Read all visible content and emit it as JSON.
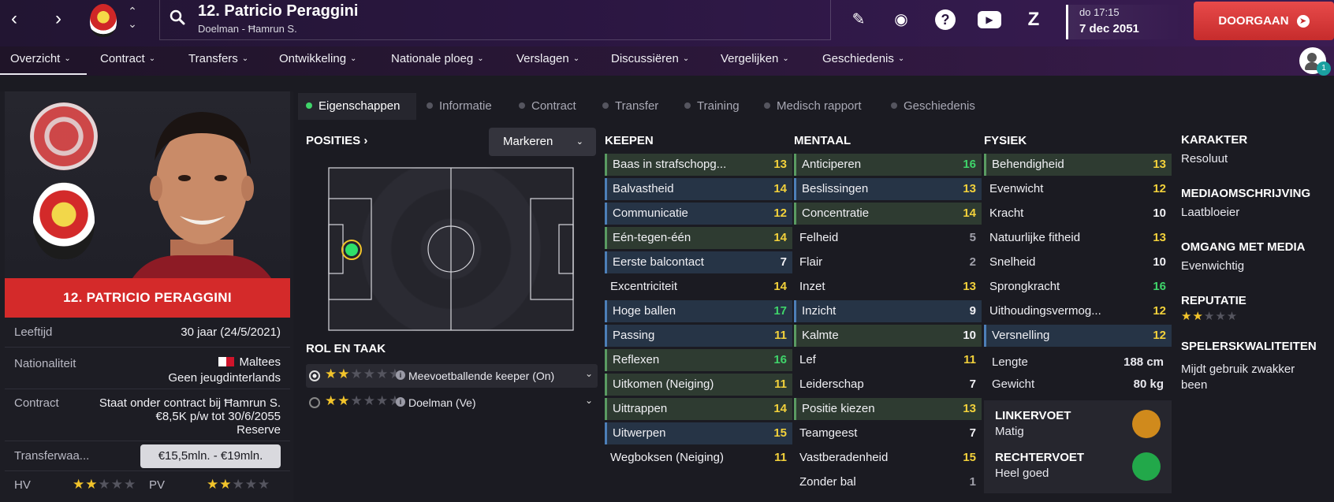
{
  "header": {
    "player_title": "12. Patricio Peraggini",
    "player_subtitle": "Doelman - Ħamrun S.",
    "date_day_time": "do 17:15",
    "date": "7 dec 2051",
    "continue_label": "DOORGAAN"
  },
  "nav": {
    "items": [
      {
        "label": "Overzicht"
      },
      {
        "label": "Contract"
      },
      {
        "label": "Transfers"
      },
      {
        "label": "Ontwikkeling"
      },
      {
        "label": "Nationale ploeg"
      },
      {
        "label": "Verslagen"
      },
      {
        "label": "Discussiëren"
      },
      {
        "label": "Vergelijken"
      },
      {
        "label": "Geschiedenis"
      }
    ],
    "social_badge": "1"
  },
  "profile": {
    "banner_name": "12. PATRICIO PERAGGINI",
    "age_label": "Leeftijd",
    "age_value": "30 jaar (24/5/2021)",
    "nationality_label": "Nationaliteit",
    "nationality_value": "Maltees",
    "nationality_sub": "Geen jeugdinterlands",
    "contract_label": "Contract",
    "contract_line1": "Staat onder contract bij Ħamrun S.",
    "contract_line2": "€8,5K p/w tot 30/6/2055",
    "contract_line3": "Reserve",
    "transfer_label": "Transferwaa...",
    "transfer_value": "€15,5mln. - €19mln.",
    "hv_label": "HV",
    "hv_stars": 2,
    "pv_label": "PV",
    "pv_stars": 2
  },
  "subtabs": [
    {
      "label": "Eigenschappen",
      "active": true
    },
    {
      "label": "Informatie"
    },
    {
      "label": "Contract"
    },
    {
      "label": "Transfer"
    },
    {
      "label": "Training"
    },
    {
      "label": "Medisch rapport"
    },
    {
      "label": "Geschiedenis"
    }
  ],
  "positions": {
    "heading": "POSITIES",
    "markeren_label": "Markeren",
    "role_heading": "ROL EN TAAK",
    "roles": [
      {
        "name": "Meevoetballende keeper (On)",
        "stars": 2,
        "selected": true
      },
      {
        "name": "Doelman (Ve)",
        "stars": 2,
        "selected": false
      }
    ]
  },
  "attributes": {
    "keepen_heading": "KEEPEN",
    "mentaal_heading": "MENTAAL",
    "fysiek_heading": "FYSIEK",
    "keepen": [
      {
        "name": "Baas in strafschopg...",
        "value": "13"
      },
      {
        "name": "Balvastheid",
        "value": "14"
      },
      {
        "name": "Communicatie",
        "value": "12"
      },
      {
        "name": "Eén-tegen-één",
        "value": "14"
      },
      {
        "name": "Eerste balcontact",
        "value": "7"
      },
      {
        "name": "Excentriciteit",
        "value": "14"
      },
      {
        "name": "Hoge ballen",
        "value": "17"
      },
      {
        "name": "Passing",
        "value": "11"
      },
      {
        "name": "Reflexen",
        "value": "16"
      },
      {
        "name": "Uitkomen (Neiging)",
        "value": "11"
      },
      {
        "name": "Uittrappen",
        "value": "14"
      },
      {
        "name": "Uitwerpen",
        "value": "15"
      },
      {
        "name": "Wegboksen (Neiging)",
        "value": "11"
      }
    ],
    "mentaal": [
      {
        "name": "Anticiperen",
        "value": "16"
      },
      {
        "name": "Beslissingen",
        "value": "13"
      },
      {
        "name": "Concentratie",
        "value": "14"
      },
      {
        "name": "Felheid",
        "value": "5"
      },
      {
        "name": "Flair",
        "value": "2"
      },
      {
        "name": "Inzet",
        "value": "13"
      },
      {
        "name": "Inzicht",
        "value": "9"
      },
      {
        "name": "Kalmte",
        "value": "10"
      },
      {
        "name": "Lef",
        "value": "11"
      },
      {
        "name": "Leiderschap",
        "value": "7"
      },
      {
        "name": "Positie kiezen",
        "value": "13"
      },
      {
        "name": "Teamgeest",
        "value": "7"
      },
      {
        "name": "Vastberadenheid",
        "value": "15"
      },
      {
        "name": "Zonder bal",
        "value": "1"
      }
    ],
    "fysiek": [
      {
        "name": "Behendigheid",
        "value": "13"
      },
      {
        "name": "Evenwicht",
        "value": "12"
      },
      {
        "name": "Kracht",
        "value": "10"
      },
      {
        "name": "Natuurlijke fitheid",
        "value": "13"
      },
      {
        "name": "Snelheid",
        "value": "10"
      },
      {
        "name": "Sprongkracht",
        "value": "16"
      },
      {
        "name": "Uithoudingsvermog...",
        "value": "12"
      },
      {
        "name": "Versnelling",
        "value": "12"
      }
    ],
    "length_label": "Lengte",
    "length_value": "188 cm",
    "weight_label": "Gewicht",
    "weight_value": "80 kg",
    "left_foot_label": "LINKERVOET",
    "left_foot_value": "Matig",
    "right_foot_label": "RECHTERVOET",
    "right_foot_value": "Heel goed"
  },
  "character": {
    "karakter_heading": "KARAKTER",
    "karakter_value": "Resoluut",
    "media_desc_heading": "MEDIAOMSCHRIJVING",
    "media_desc_value": "Laatbloeier",
    "media_handling_heading": "OMGANG MET MEDIA",
    "media_handling_value": "Evenwichtig",
    "reputation_heading": "REPUTATIE",
    "reputation_stars": 2,
    "qualities_heading": "SPELERSKWALITEITEN",
    "qualities_value": "Mijdt gebruik zwakker been"
  },
  "colors": {
    "accent_red": "#d42a2a",
    "value_green": "#3fd46a",
    "value_yellow": "#f2d13b",
    "left_foot": "#d08a1c",
    "right_foot": "#22a84a"
  }
}
